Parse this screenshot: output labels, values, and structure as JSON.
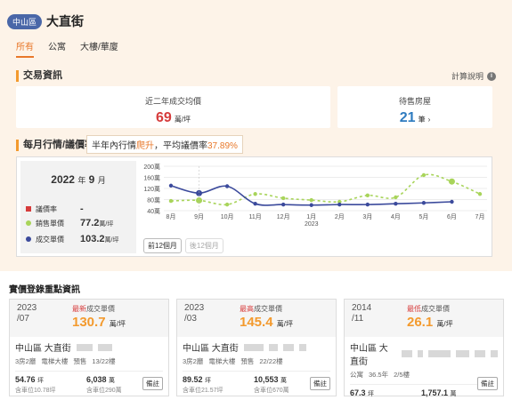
{
  "header": {
    "district_badge": "中山區",
    "street": "大直街"
  },
  "tabs": [
    {
      "label": "所有"
    },
    {
      "label": "公寓"
    },
    {
      "label": "大樓/華廈"
    }
  ],
  "transaction": {
    "heading": "交易資訊",
    "calc_link": "計算說明",
    "avg_label": "近二年成交均價",
    "avg_value": "69",
    "avg_unit": "萬/坪",
    "listing_label": "待售房屋",
    "listing_value": "21",
    "listing_unit": "筆",
    "listing_arrow": "›"
  },
  "monthly": {
    "heading": "每月行情/議價率",
    "tip_prefix": "半年內行情",
    "tip_trend": "爬升",
    "tip_mid": "，平均議價率",
    "tip_rate": "37.89%",
    "selected_year": "2022",
    "year_suffix": "年",
    "selected_month": "9",
    "month_suffix": "月",
    "legend": {
      "rate_label": "議價率",
      "rate_value": "-",
      "ask_label": "銷售單價",
      "ask_value": "77.2",
      "ask_unit": "萬/坪",
      "deal_label": "成交單價",
      "deal_value": "103.2",
      "deal_unit": "萬/坪"
    },
    "range_buttons": [
      "前12個月",
      "後12個月"
    ]
  },
  "colors": {
    "accent": "#f39a2e",
    "red": "#d63b3b",
    "blue": "#2e7bbf",
    "deal_line": "#3b4a9c",
    "ask_line": "#a8d45a"
  },
  "chart_data": {
    "type": "line",
    "x": [
      "8月",
      "9月",
      "10月",
      "11月",
      "12月",
      "1月",
      "2月",
      "3月",
      "4月",
      "5月",
      "6月",
      "7月"
    ],
    "year_label": "2023",
    "yticks": [
      "200萬",
      "160萬",
      "120萬",
      "80萬",
      "40萬"
    ],
    "ylim": [
      40,
      200
    ],
    "series": [
      {
        "name": "銷售單價",
        "values": [
          75,
          77,
          62,
          100,
          85,
          78,
          72,
          95,
          88,
          168,
          145,
          100
        ]
      },
      {
        "name": "成交單價",
        "values": [
          130,
          103,
          128,
          65,
          62,
          60,
          62,
          62,
          65,
          68,
          72,
          null
        ]
      }
    ],
    "highlight_index": 1
  },
  "deals": {
    "heading": "實價登錄重點資訊",
    "cards": [
      {
        "year": "2023",
        "month": "/07",
        "tag_prefix": "最新",
        "tag_suffix": "成交單價",
        "price": "130.7",
        "price_unit": "萬/坪",
        "addr": "中山區 大直街",
        "meta": [
          "3房2廳",
          "電梯大樓",
          "預售",
          "13/22樓"
        ],
        "area": "54.76",
        "area_unit": "坪",
        "area_sub": "含車位10.78坪",
        "total": "6,038",
        "total_unit": "萬",
        "total_sub": "含車位290萬",
        "remark": "備註"
      },
      {
        "year": "2023",
        "month": "/03",
        "tag_prefix": "最高",
        "tag_suffix": "成交單價",
        "price": "145.4",
        "price_unit": "萬/坪",
        "addr": "中山區 大直街",
        "meta": [
          "3房2廳",
          "電梯大樓",
          "預售",
          "22/22樓"
        ],
        "area": "89.52",
        "area_unit": "坪",
        "area_sub": "含車位21.57坪",
        "total": "10,553",
        "total_unit": "萬",
        "total_sub": "含車位670萬",
        "remark": "備註"
      },
      {
        "year": "2014",
        "month": "/11",
        "tag_prefix": "最低",
        "tag_suffix": "成交單價",
        "price": "26.1",
        "price_unit": "萬/坪",
        "addr": "中山區 大直街",
        "meta": [
          "公寓",
          "36.5年",
          "2/5樓"
        ],
        "area": "67.3",
        "area_unit": "坪",
        "area_sub": "",
        "total": "1,757.1",
        "total_unit": "萬",
        "total_sub": "",
        "remark": "備註"
      }
    ]
  }
}
